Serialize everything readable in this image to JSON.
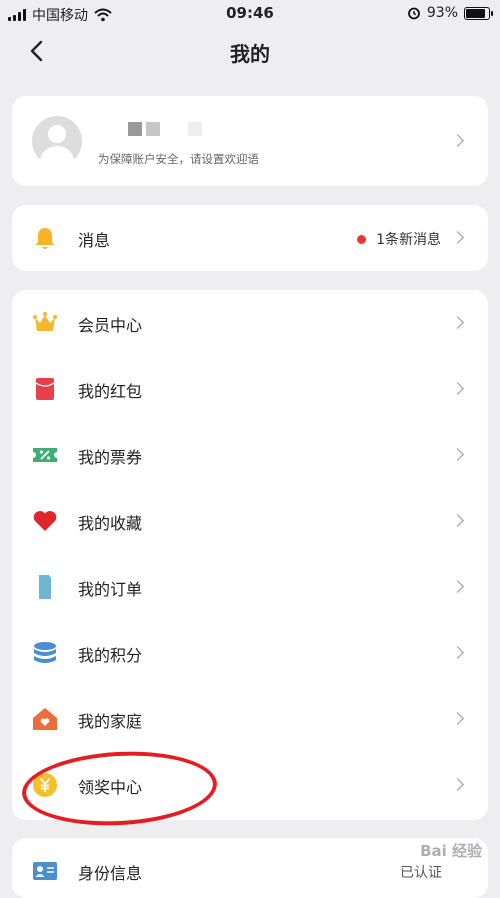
{
  "status_bar": {
    "carrier": "中国移动",
    "time": "09:46",
    "battery": "93%",
    "battery_level": 0.93
  },
  "nav": {
    "title": "我的"
  },
  "profile": {
    "subtitle": "为保障账户安全，请设置欢迎语"
  },
  "messages": {
    "label": "消息",
    "note": "1条新消息"
  },
  "menu": [
    {
      "label": "会员中心",
      "icon": "crown-icon"
    },
    {
      "label": "我的红包",
      "icon": "red-envelope-icon"
    },
    {
      "label": "我的票券",
      "icon": "ticket-icon"
    },
    {
      "label": "我的收藏",
      "icon": "heart-icon"
    },
    {
      "label": "我的订单",
      "icon": "order-icon"
    },
    {
      "label": "我的积分",
      "icon": "coin-stack-icon"
    },
    {
      "label": "我的家庭",
      "icon": "home-icon"
    },
    {
      "label": "领奖中心",
      "icon": "yuan-coin-icon"
    }
  ],
  "identity": {
    "label": "身份信息",
    "status": "已认证"
  },
  "watermark": "Bai 经验"
}
